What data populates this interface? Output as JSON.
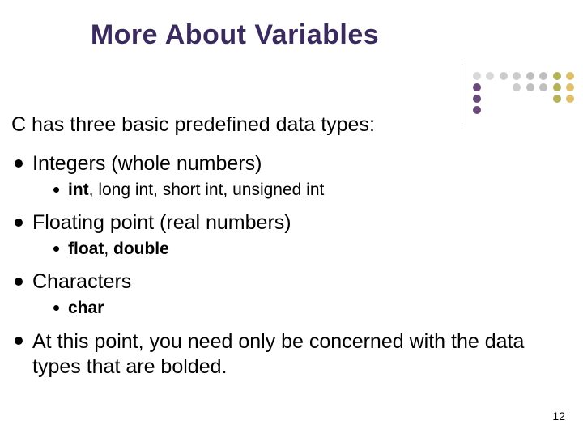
{
  "title": "More About Variables",
  "intro": "C has three basic predefined data types:",
  "items": {
    "a": {
      "head": "Integers (whole numbers)",
      "sub_bold": "int",
      "sub_rest": ", long int, short int, unsigned int"
    },
    "b": {
      "head": "Floating point (real numbers)",
      "sub_bold": "float",
      "sub_mid": ", ",
      "sub_bold2": "double"
    },
    "c": {
      "head": "Characters",
      "sub_bold": "char"
    },
    "d": {
      "head": "At this point, you need only be concerned with the data types that are bolded."
    }
  },
  "pagenum": "12",
  "decor": {
    "colors": {
      "olive": "#b3b35a",
      "gold": "#e0c06a",
      "purple": "#6b4a7a",
      "grey1": "#d9d9d9",
      "grey2": "#cccccc",
      "grey3": "#bfbfbf"
    }
  }
}
